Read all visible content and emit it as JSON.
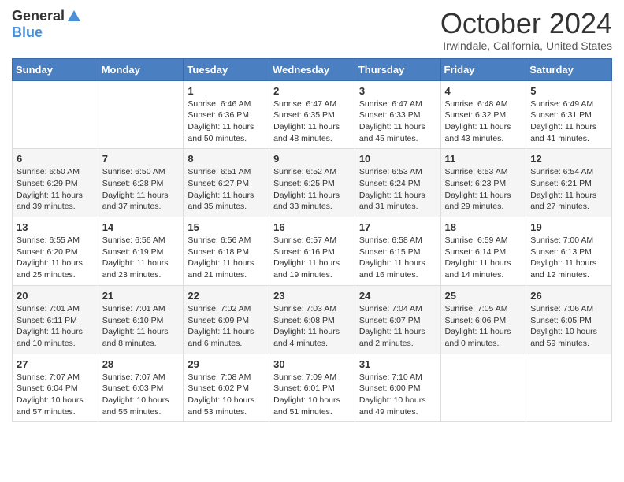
{
  "header": {
    "logo_general": "General",
    "logo_blue": "Blue",
    "title": "October 2024",
    "subtitle": "Irwindale, California, United States"
  },
  "weekdays": [
    "Sunday",
    "Monday",
    "Tuesday",
    "Wednesday",
    "Thursday",
    "Friday",
    "Saturday"
  ],
  "weeks": [
    [
      {
        "day": null,
        "sunrise": null,
        "sunset": null,
        "daylight": null
      },
      {
        "day": null,
        "sunrise": null,
        "sunset": null,
        "daylight": null
      },
      {
        "day": "1",
        "sunrise": "6:46 AM",
        "sunset": "6:36 PM",
        "daylight": "11 hours and 50 minutes."
      },
      {
        "day": "2",
        "sunrise": "6:47 AM",
        "sunset": "6:35 PM",
        "daylight": "11 hours and 48 minutes."
      },
      {
        "day": "3",
        "sunrise": "6:47 AM",
        "sunset": "6:33 PM",
        "daylight": "11 hours and 45 minutes."
      },
      {
        "day": "4",
        "sunrise": "6:48 AM",
        "sunset": "6:32 PM",
        "daylight": "11 hours and 43 minutes."
      },
      {
        "day": "5",
        "sunrise": "6:49 AM",
        "sunset": "6:31 PM",
        "daylight": "11 hours and 41 minutes."
      }
    ],
    [
      {
        "day": "6",
        "sunrise": "6:50 AM",
        "sunset": "6:29 PM",
        "daylight": "11 hours and 39 minutes."
      },
      {
        "day": "7",
        "sunrise": "6:50 AM",
        "sunset": "6:28 PM",
        "daylight": "11 hours and 37 minutes."
      },
      {
        "day": "8",
        "sunrise": "6:51 AM",
        "sunset": "6:27 PM",
        "daylight": "11 hours and 35 minutes."
      },
      {
        "day": "9",
        "sunrise": "6:52 AM",
        "sunset": "6:25 PM",
        "daylight": "11 hours and 33 minutes."
      },
      {
        "day": "10",
        "sunrise": "6:53 AM",
        "sunset": "6:24 PM",
        "daylight": "11 hours and 31 minutes."
      },
      {
        "day": "11",
        "sunrise": "6:53 AM",
        "sunset": "6:23 PM",
        "daylight": "11 hours and 29 minutes."
      },
      {
        "day": "12",
        "sunrise": "6:54 AM",
        "sunset": "6:21 PM",
        "daylight": "11 hours and 27 minutes."
      }
    ],
    [
      {
        "day": "13",
        "sunrise": "6:55 AM",
        "sunset": "6:20 PM",
        "daylight": "11 hours and 25 minutes."
      },
      {
        "day": "14",
        "sunrise": "6:56 AM",
        "sunset": "6:19 PM",
        "daylight": "11 hours and 23 minutes."
      },
      {
        "day": "15",
        "sunrise": "6:56 AM",
        "sunset": "6:18 PM",
        "daylight": "11 hours and 21 minutes."
      },
      {
        "day": "16",
        "sunrise": "6:57 AM",
        "sunset": "6:16 PM",
        "daylight": "11 hours and 19 minutes."
      },
      {
        "day": "17",
        "sunrise": "6:58 AM",
        "sunset": "6:15 PM",
        "daylight": "11 hours and 16 minutes."
      },
      {
        "day": "18",
        "sunrise": "6:59 AM",
        "sunset": "6:14 PM",
        "daylight": "11 hours and 14 minutes."
      },
      {
        "day": "19",
        "sunrise": "7:00 AM",
        "sunset": "6:13 PM",
        "daylight": "11 hours and 12 minutes."
      }
    ],
    [
      {
        "day": "20",
        "sunrise": "7:01 AM",
        "sunset": "6:11 PM",
        "daylight": "11 hours and 10 minutes."
      },
      {
        "day": "21",
        "sunrise": "7:01 AM",
        "sunset": "6:10 PM",
        "daylight": "11 hours and 8 minutes."
      },
      {
        "day": "22",
        "sunrise": "7:02 AM",
        "sunset": "6:09 PM",
        "daylight": "11 hours and 6 minutes."
      },
      {
        "day": "23",
        "sunrise": "7:03 AM",
        "sunset": "6:08 PM",
        "daylight": "11 hours and 4 minutes."
      },
      {
        "day": "24",
        "sunrise": "7:04 AM",
        "sunset": "6:07 PM",
        "daylight": "11 hours and 2 minutes."
      },
      {
        "day": "25",
        "sunrise": "7:05 AM",
        "sunset": "6:06 PM",
        "daylight": "11 hours and 0 minutes."
      },
      {
        "day": "26",
        "sunrise": "7:06 AM",
        "sunset": "6:05 PM",
        "daylight": "10 hours and 59 minutes."
      }
    ],
    [
      {
        "day": "27",
        "sunrise": "7:07 AM",
        "sunset": "6:04 PM",
        "daylight": "10 hours and 57 minutes."
      },
      {
        "day": "28",
        "sunrise": "7:07 AM",
        "sunset": "6:03 PM",
        "daylight": "10 hours and 55 minutes."
      },
      {
        "day": "29",
        "sunrise": "7:08 AM",
        "sunset": "6:02 PM",
        "daylight": "10 hours and 53 minutes."
      },
      {
        "day": "30",
        "sunrise": "7:09 AM",
        "sunset": "6:01 PM",
        "daylight": "10 hours and 51 minutes."
      },
      {
        "day": "31",
        "sunrise": "7:10 AM",
        "sunset": "6:00 PM",
        "daylight": "10 hours and 49 minutes."
      },
      {
        "day": null,
        "sunrise": null,
        "sunset": null,
        "daylight": null
      },
      {
        "day": null,
        "sunrise": null,
        "sunset": null,
        "daylight": null
      }
    ]
  ],
  "labels": {
    "sunrise_prefix": "Sunrise: ",
    "sunset_prefix": "Sunset: ",
    "daylight_prefix": "Daylight: "
  }
}
